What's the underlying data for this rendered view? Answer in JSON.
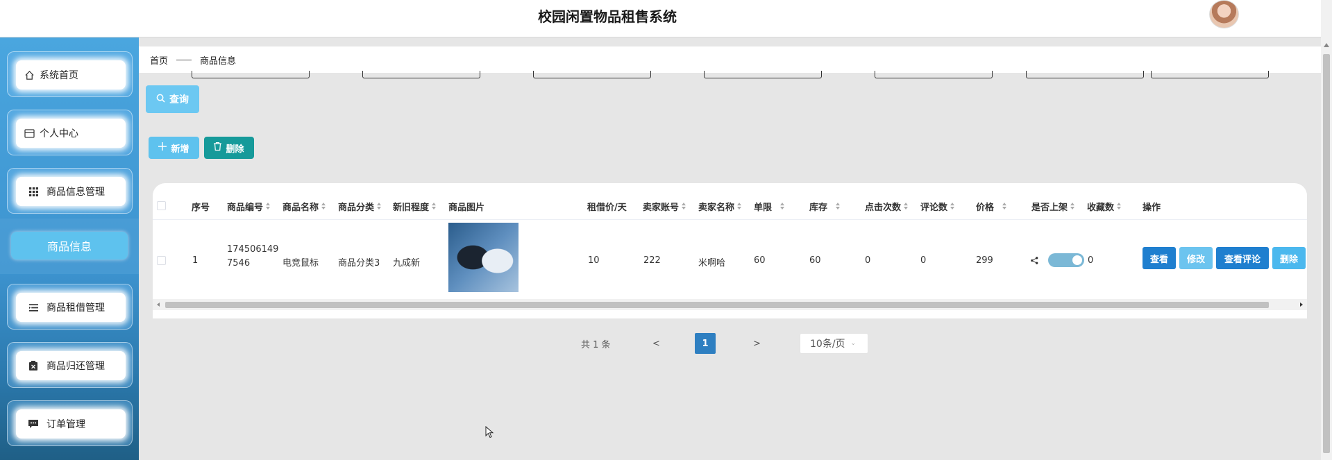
{
  "header": {
    "title": "校园闲置物品租售系统"
  },
  "sidebar": {
    "items": [
      {
        "label": "系统首页",
        "icon": "home-icon"
      },
      {
        "label": "个人中心",
        "icon": "id-card-icon"
      },
      {
        "label": "商品信息管理",
        "icon": "grid-icon"
      },
      {
        "label": "商品租借管理",
        "icon": "list-icon"
      },
      {
        "label": "商品归还管理",
        "icon": "clipboard-icon"
      },
      {
        "label": "订单管理",
        "icon": "chat-icon"
      }
    ],
    "active_sub": "商品信息"
  },
  "breadcrumb": {
    "home": "首页",
    "current": "商品信息"
  },
  "toolbar": {
    "query_label": "查询",
    "add_label": "新增",
    "delete_label": "删除"
  },
  "table": {
    "headers": [
      "序号",
      "商品编号",
      "商品名称",
      "商品分类",
      "新旧程度",
      "商品图片",
      "租借价/天",
      "卖家账号",
      "卖家名称",
      "单限",
      "库存",
      "点击次数",
      "评论数",
      "价格",
      "是否上架",
      "收藏数",
      "操作"
    ],
    "rows": [
      {
        "index": "1",
        "code_line1": "174506149",
        "code_line2": "7546",
        "name": "电竞鼠标",
        "category": "商品分类3",
        "condition": "九成新",
        "rent_price": "10",
        "seller_account": "222",
        "seller_name": "米啊哈",
        "limit": "60",
        "stock": "60",
        "clicks": "0",
        "comments": "0",
        "price": "299",
        "on_shelf": true,
        "favorites": "0"
      }
    ],
    "actions": {
      "view": "查看",
      "edit": "修改",
      "view_comments": "查看评论",
      "delete": "删除"
    }
  },
  "pagination": {
    "total": "共 1 条",
    "prev": "<",
    "current": "1",
    "next": ">",
    "page_size": "10条/页"
  },
  "colors": {
    "primary": "#2e7fc1",
    "accent": "#5ec2ee",
    "danger_teal": "#169a9a"
  }
}
